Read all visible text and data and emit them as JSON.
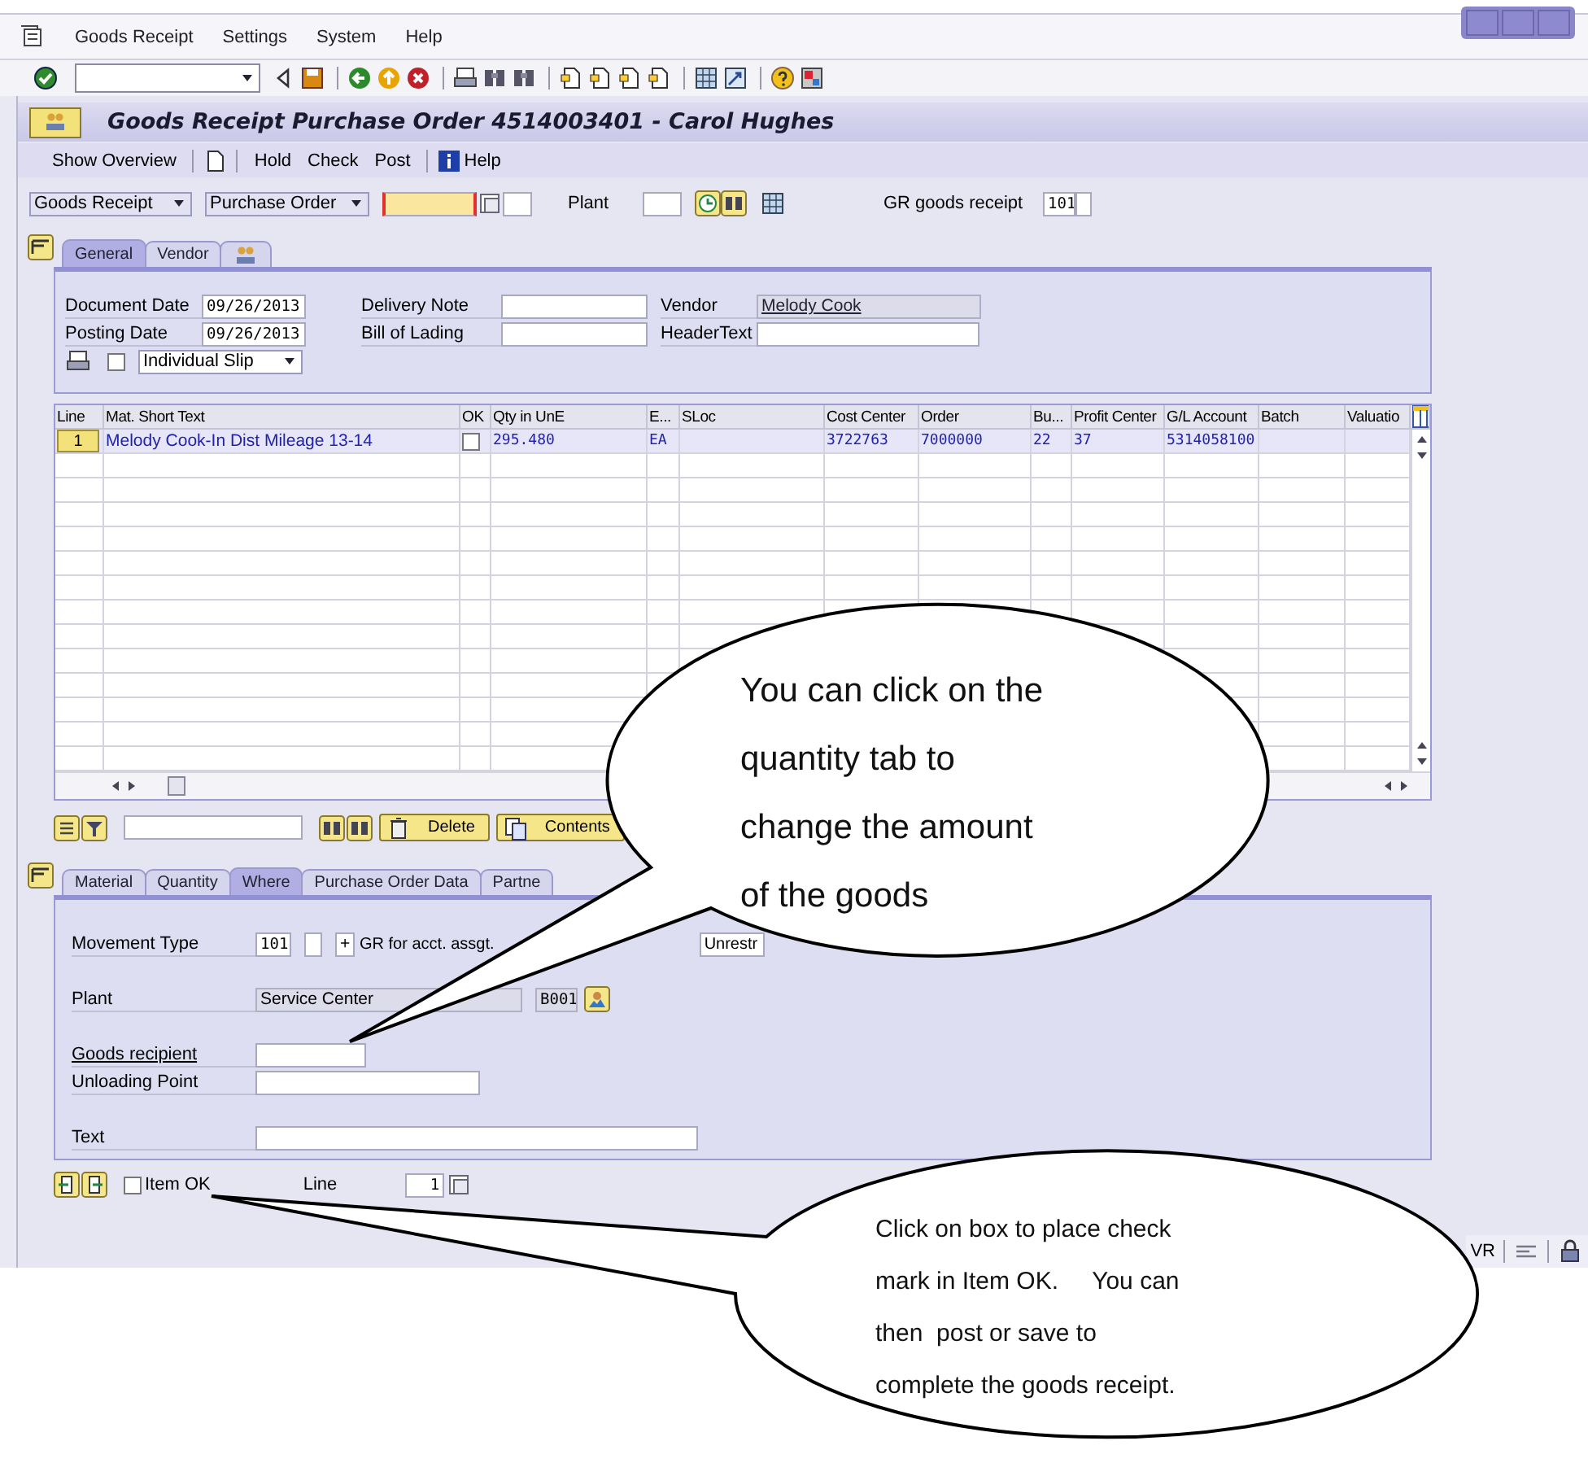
{
  "menu": [
    {
      "label": "Goods Receipt"
    },
    {
      "label": "Settings"
    },
    {
      "label": "System"
    },
    {
      "label": "Help"
    }
  ],
  "title": "Goods Receipt Purchase Order 4514003401 - Carol Hughes",
  "app_toolbar": [
    {
      "kind": "text",
      "label": "Show Overview"
    },
    {
      "kind": "icon"
    },
    {
      "kind": "text",
      "label": "Hold"
    },
    {
      "kind": "text",
      "label": "Check"
    },
    {
      "kind": "text",
      "label": "Post"
    },
    {
      "kind": "info",
      "label": "Help"
    }
  ],
  "selection": {
    "transaction": "Goods Receipt",
    "reference": "Purchase Order",
    "plant_label": "Plant",
    "movement_label": "GR goods receipt",
    "movement_value": "101"
  },
  "header_tabs": [
    {
      "kind": "text",
      "label": "General",
      "selected": true
    },
    {
      "kind": "text",
      "label": "Vendor",
      "selected": false
    },
    {
      "kind": "icon",
      "selected": false
    }
  ],
  "general": {
    "document_date_label": "Document Date",
    "document_date": "09/26/2013",
    "posting_date_label": "Posting Date",
    "posting_date": "09/26/2013",
    "delivery_note_label": "Delivery Note",
    "bill_of_lading_label": "Bill of Lading",
    "vendor_label": "Vendor",
    "vendor": "Melody Cook",
    "header_text_label": "HeaderText",
    "print_checked": false,
    "slip": "Individual Slip"
  },
  "items_table": {
    "columns": [
      {
        "label": "Line"
      },
      {
        "label": "Mat. Short Text"
      },
      {
        "label": "OK"
      },
      {
        "label": "Qty in UnE"
      },
      {
        "label": "E..."
      },
      {
        "label": "SLoc"
      },
      {
        "label": "Cost Center"
      },
      {
        "label": "Order"
      },
      {
        "label": "Bu..."
      },
      {
        "label": "Profit Center"
      },
      {
        "label": "G/L Account"
      },
      {
        "label": "Batch"
      },
      {
        "label": "Valuatio"
      }
    ],
    "rows": [
      {
        "line": "1",
        "text": "Melody Cook-In Dist Mileage 13-14",
        "ok": false,
        "qty": "295.480",
        "unit": "EA",
        "cost_center": "3722763",
        "order": "7000000",
        "bu": "22",
        "profit_center": "37",
        "gl_account": "5314058100"
      }
    ]
  },
  "table_toolbar": {
    "buttons": [
      {
        "label": "Delete"
      },
      {
        "label": "Contents"
      }
    ]
  },
  "detail_tabs": [
    {
      "label": "Material",
      "selected": false
    },
    {
      "label": "Quantity",
      "selected": false
    },
    {
      "label": "Where",
      "selected": true
    },
    {
      "label": "Purchase Order Data",
      "selected": false
    },
    {
      "label": "Partne",
      "selected": false
    }
  ],
  "where": {
    "movement_type_label": "Movement Type",
    "movement_type": "101",
    "plus": "+",
    "movement_text": "GR for acct. assgt.",
    "stock_type": "Unrestr",
    "plant_label": "Plant",
    "plant_name": "Service Center",
    "plant_code": "B001",
    "goods_recipient_label": "Goods recipient",
    "unloading_point_label": "Unloading Point",
    "text_label": "Text"
  },
  "footer": {
    "item_ok_label": "Item OK",
    "item_ok_checked": false,
    "line_label": "Line",
    "line_value": "1"
  },
  "status_bar": {
    "mode": "VR"
  },
  "callouts": [
    {
      "lines": [
        "You can click on the",
        "quantity tab to",
        "change the amount",
        "of the goods"
      ]
    },
    {
      "lines": [
        "Click on box to place check",
        "mark in Item OK.     You can",
        "then  post or save to",
        "complete the goods receipt."
      ]
    }
  ]
}
